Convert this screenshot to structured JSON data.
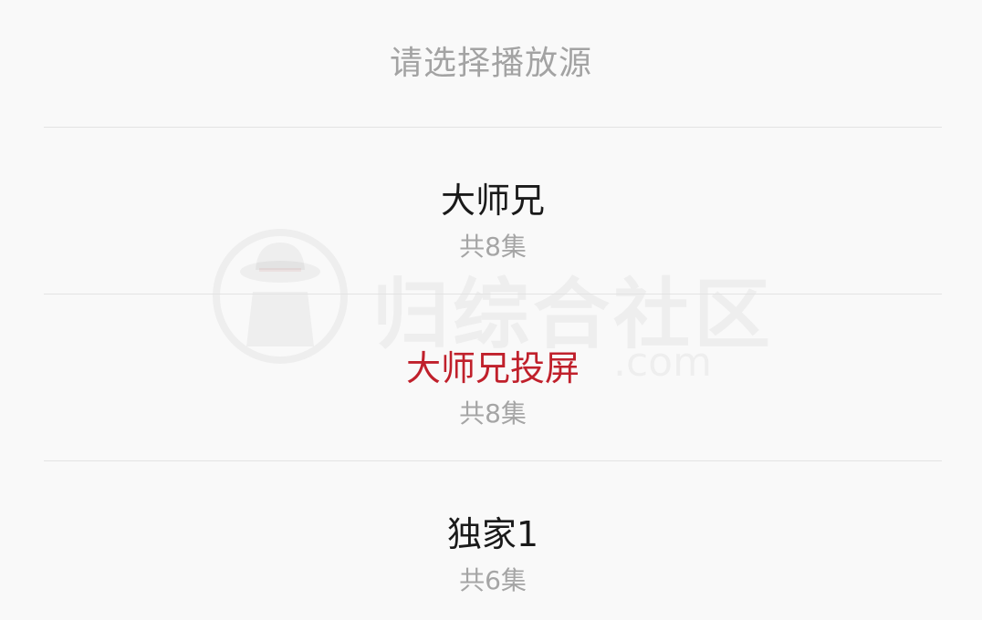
{
  "dialog": {
    "title": "请选择播放源"
  },
  "sources": [
    {
      "name": "大师兄",
      "count": "共8集",
      "selected": false
    },
    {
      "name": "大师兄投屏",
      "count": "共8集",
      "selected": true
    },
    {
      "name": "独家1",
      "count": "共6集",
      "selected": false
    }
  ],
  "watermark": {
    "text": "归综合社区",
    "sub": ".com",
    "icon": "spy-hat-icon"
  },
  "colors": {
    "background": "#f9f9f9",
    "title": "#a3a3a3",
    "item_text": "#1a1a1a",
    "selected_text": "#c0202b",
    "secondary_text": "#a5a5a5",
    "divider": "#e3e3e3"
  }
}
